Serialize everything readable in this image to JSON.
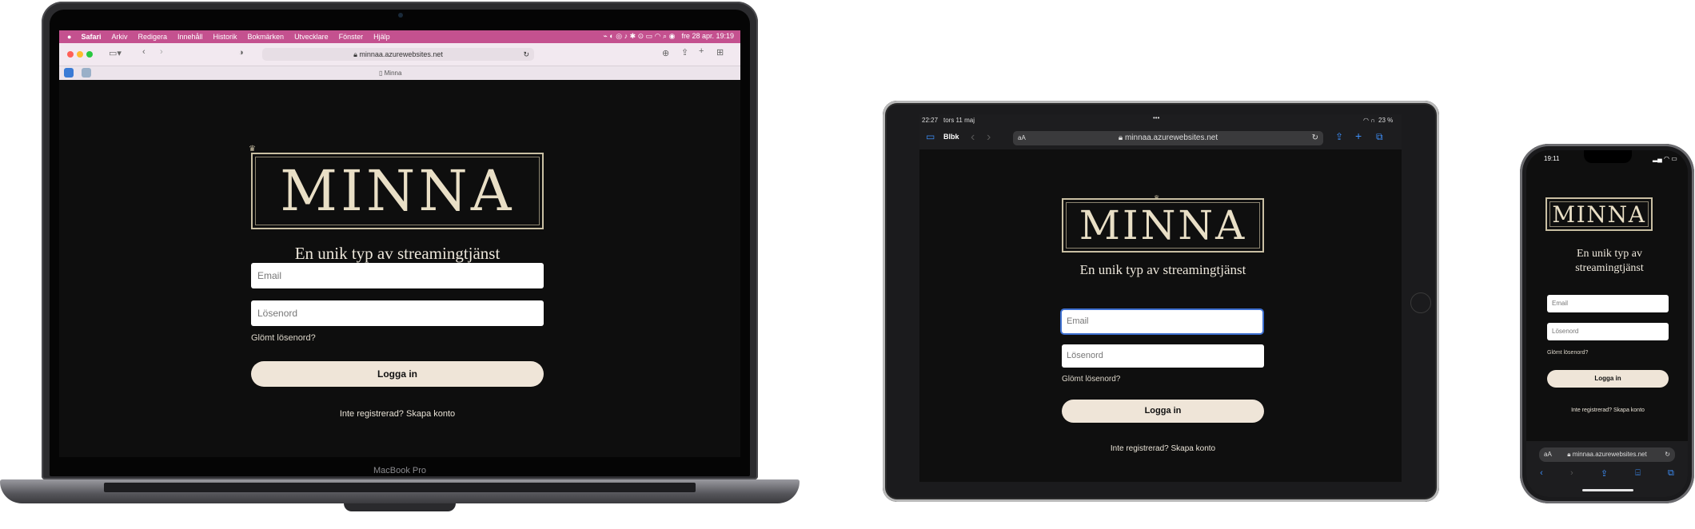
{
  "macbook": {
    "brand_label": "MacBook Pro",
    "menubar": {
      "apple": "",
      "items": [
        "Safari",
        "Arkiv",
        "Redigera",
        "Innehåll",
        "Historik",
        "Bokmärken",
        "Utvecklare",
        "Fönster",
        "Hjälp"
      ],
      "clock": "fre 28 apr.  19:19"
    },
    "url": "minnaa.azurewebsites.net",
    "tab_title": "Minna"
  },
  "ipad": {
    "time": "22:27",
    "date": "tors 11 maj",
    "battery": "23 %",
    "bookmarks_label": "Blbk",
    "text_size": "aA",
    "url": "minnaa.azurewebsites.net"
  },
  "iphone": {
    "time": "19:11",
    "text_size": "aA",
    "url": "minnaa.azurewebsites.net"
  },
  "page": {
    "logo_text": "MINNA",
    "tagline": "En unik typ av streamingtjänst",
    "email_placeholder": "Email",
    "password_placeholder": "Lösenord",
    "forgot_password": "Glömt lösenord?",
    "login_button": "Logga in",
    "not_registered": "Inte registrerad?",
    "create_account": "Skapa konto"
  },
  "colors": {
    "page_bg": "#0e0e0e",
    "accent_button": "#efe5d8",
    "logo_gold": "#c9bfa3",
    "mac_menubar": "#c4518f"
  }
}
